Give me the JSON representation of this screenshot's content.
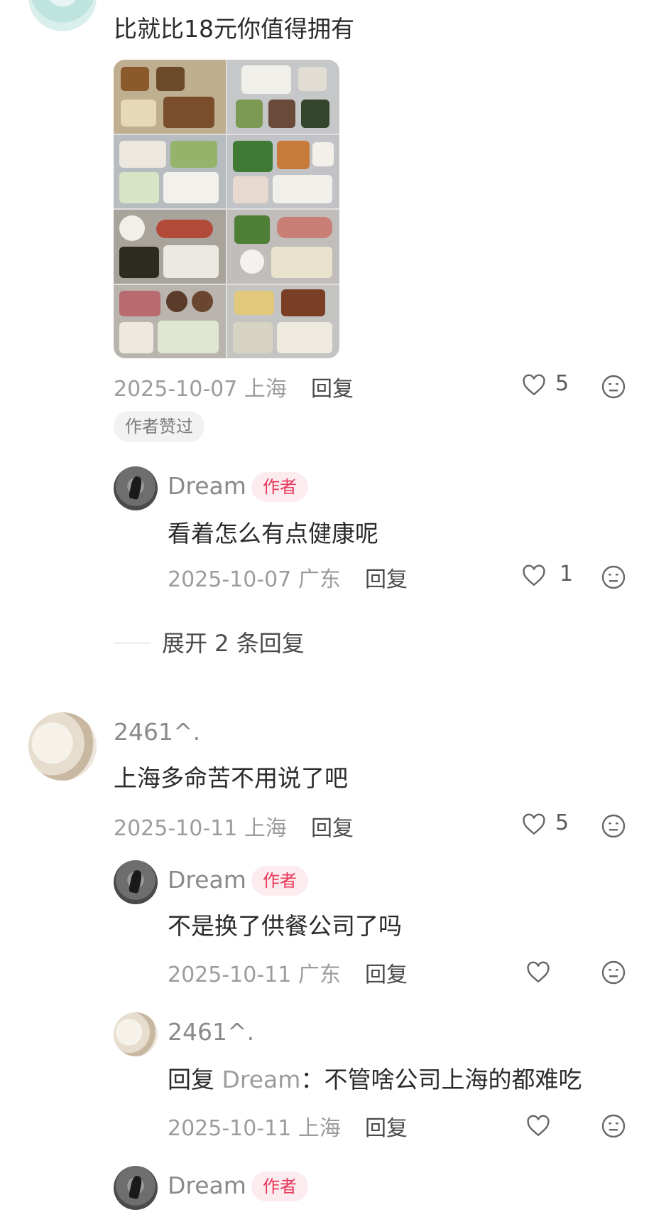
{
  "comments": [
    {
      "text": "比就比18元你值得拥有",
      "date": "2025-10-07",
      "location": "上海",
      "reply_label": "回复",
      "likes": "5",
      "author_liked": "作者赞过",
      "replies": [
        {
          "user": "Dream",
          "badge": "作者",
          "text": "看着怎么有点健康呢",
          "date": "2025-10-07",
          "location": "广东",
          "reply_label": "回复",
          "likes": "1"
        }
      ],
      "expand_label": "展开 2 条回复"
    },
    {
      "user": "2461^.",
      "text": "上海多命苦不用说了吧",
      "date": "2025-10-11",
      "location": "上海",
      "reply_label": "回复",
      "likes": "5",
      "replies": [
        {
          "user": "Dream",
          "badge": "作者",
          "text": "不是换了供餐公司了吗",
          "date": "2025-10-11",
          "location": "广东",
          "reply_label": "回复"
        },
        {
          "user": "2461^.",
          "reply_prefix": "回复",
          "reply_target": "Dream",
          "text": "：不管啥公司上海的都难吃",
          "date": "2025-10-11",
          "location": "上海",
          "reply_label": "回复"
        },
        {
          "user": "Dream",
          "badge": "作者"
        }
      ]
    }
  ],
  "colors": {
    "author_badge": "#e8385a",
    "meta_gray": "#9c9c9c"
  },
  "icons": {
    "like": "heart-outline-icon",
    "reaction": "meh-face-icon"
  }
}
